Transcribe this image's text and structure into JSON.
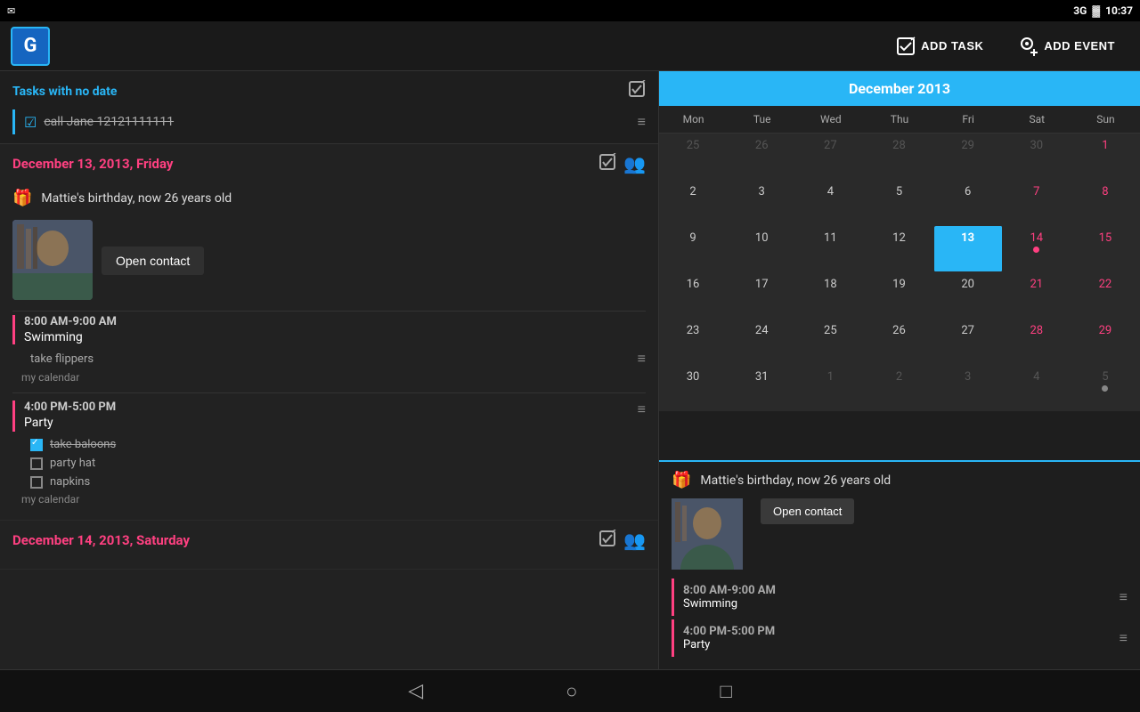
{
  "statusBar": {
    "leftIcon": "✉",
    "network": "3G",
    "time": "10:37"
  },
  "topBar": {
    "appLogo": "G",
    "addTaskLabel": "ADD TASK",
    "addEventLabel": "ADD EVENT"
  },
  "leftPanel": {
    "tasksSection": {
      "title": "Tasks with no date",
      "task": {
        "checked": true,
        "text": "call Jane 12121111111"
      }
    },
    "day1": {
      "title": "December 13, 2013, Friday",
      "birthdayEvent": "Mattie's birthday, now 26 years old",
      "openContactBtn": "Open contact",
      "events": [
        {
          "time": "8:00 AM-9:00 AM",
          "name": "Swimming",
          "note": "take flippers",
          "calendar": "my calendar"
        },
        {
          "time": "4:00 PM-5:00 PM",
          "name": "Party",
          "tasks": [
            {
              "done": true,
              "text": "take baloons"
            },
            {
              "done": false,
              "text": "party hat"
            },
            {
              "done": false,
              "text": "napkins"
            }
          ],
          "calendar": "my calendar"
        }
      ]
    },
    "day2": {
      "title": "December 14, 2013, Saturday"
    }
  },
  "calendar": {
    "title": "December 2013",
    "dayHeaders": [
      "Mon",
      "Tue",
      "Wed",
      "Thu",
      "Fri",
      "Sat",
      "Sun"
    ],
    "weeks": [
      [
        {
          "num": "25",
          "type": "other"
        },
        {
          "num": "26",
          "type": "other"
        },
        {
          "num": "27",
          "type": "other"
        },
        {
          "num": "28",
          "type": "other"
        },
        {
          "num": "29",
          "type": "other"
        },
        {
          "num": "30",
          "type": "other"
        },
        {
          "num": "1",
          "type": "weekend"
        }
      ],
      [
        {
          "num": "2",
          "type": "normal"
        },
        {
          "num": "3",
          "type": "normal"
        },
        {
          "num": "4",
          "type": "normal"
        },
        {
          "num": "5",
          "type": "normal"
        },
        {
          "num": "6",
          "type": "normal"
        },
        {
          "num": "7",
          "type": "weekend"
        },
        {
          "num": "8",
          "type": "weekend"
        }
      ],
      [
        {
          "num": "9",
          "type": "normal"
        },
        {
          "num": "10",
          "type": "normal"
        },
        {
          "num": "11",
          "type": "normal"
        },
        {
          "num": "12",
          "type": "normal"
        },
        {
          "num": "13",
          "type": "today",
          "dot": "blue"
        },
        {
          "num": "14",
          "type": "weekend",
          "dot": "pink"
        },
        {
          "num": "15",
          "type": "weekend"
        }
      ],
      [
        {
          "num": "16",
          "type": "normal"
        },
        {
          "num": "17",
          "type": "normal"
        },
        {
          "num": "18",
          "type": "normal"
        },
        {
          "num": "19",
          "type": "normal"
        },
        {
          "num": "20",
          "type": "normal"
        },
        {
          "num": "21",
          "type": "weekend"
        },
        {
          "num": "22",
          "type": "weekend"
        }
      ],
      [
        {
          "num": "23",
          "type": "normal"
        },
        {
          "num": "24",
          "type": "normal"
        },
        {
          "num": "25",
          "type": "normal"
        },
        {
          "num": "26",
          "type": "normal"
        },
        {
          "num": "27",
          "type": "normal"
        },
        {
          "num": "28",
          "type": "weekend"
        },
        {
          "num": "29",
          "type": "weekend"
        }
      ],
      [
        {
          "num": "30",
          "type": "normal"
        },
        {
          "num": "31",
          "type": "normal"
        },
        {
          "num": "1",
          "type": "other"
        },
        {
          "num": "2",
          "type": "other"
        },
        {
          "num": "3",
          "type": "other"
        },
        {
          "num": "4",
          "type": "other"
        },
        {
          "num": "5",
          "type": "other",
          "dot": "gray"
        }
      ]
    ]
  },
  "eventPanel": {
    "birthdayText": "Mattie's birthday, now 26 years old",
    "openContactBtn": "Open contact",
    "events": [
      {
        "time": "8:00 AM-9:00 AM",
        "name": "Swimming"
      },
      {
        "time": "4:00 PM-5:00 PM",
        "name": "Party"
      }
    ]
  },
  "bottomNav": {
    "back": "◁",
    "home": "○",
    "recents": "□"
  }
}
